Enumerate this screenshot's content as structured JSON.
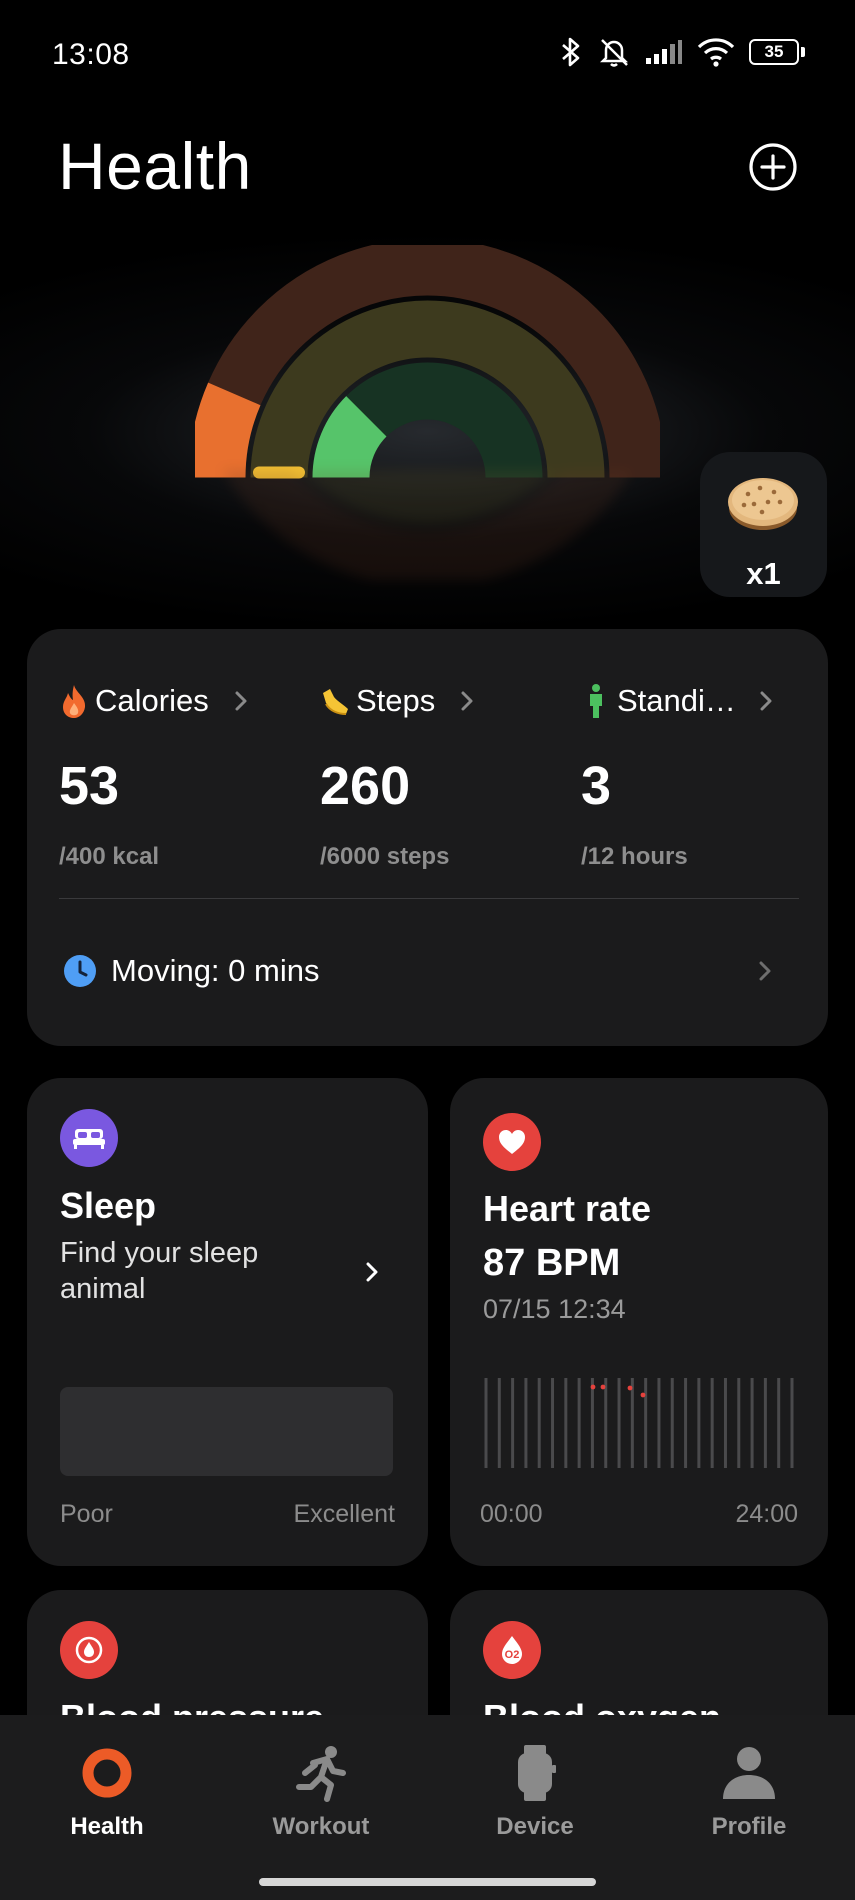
{
  "status_bar": {
    "time": "13:08",
    "battery": "35",
    "icons": [
      "bluetooth-icon",
      "mute-notifications-icon",
      "signal-icon",
      "wifi-icon",
      "battery-icon"
    ]
  },
  "header": {
    "title": "Health",
    "add_icon": "plus-circle-icon"
  },
  "rings": {
    "calories_progress": 0.13,
    "steps_progress": 0.04,
    "standing_progress": 0.25,
    "colors": {
      "calories": "#e8702f",
      "steps": "#f3c033",
      "standing": "#56c46a"
    }
  },
  "reward": {
    "icon": "cookie-icon",
    "count": "x1"
  },
  "activity": {
    "metrics": [
      {
        "label": "Calories",
        "value": "53",
        "goal": "/400 kcal",
        "icon": "flame-icon",
        "color": "#f26a2e"
      },
      {
        "label": "Steps",
        "value": "260",
        "goal": "/6000 steps",
        "icon": "shoe-icon",
        "color": "#f5c435"
      },
      {
        "label": "Standi…",
        "value": "3",
        "goal": "/12 hours",
        "icon": "standing-person-icon",
        "color": "#4cc05f"
      }
    ],
    "moving": {
      "label": "Moving: 0 mins",
      "icon": "clock-icon"
    }
  },
  "sleep": {
    "title": "Sleep",
    "subtitle": "Find your sleep animal",
    "scale_low": "Poor",
    "scale_high": "Excellent",
    "icon": "bed-icon"
  },
  "heart_rate": {
    "title": "Heart rate",
    "value": "87 BPM",
    "timestamp": "07/15 12:34",
    "axis_start": "00:00",
    "axis_end": "24:00",
    "icon": "heart-icon"
  },
  "blood_pressure": {
    "title": "Blood pressure",
    "icon": "blood-drop-icon"
  },
  "blood_oxygen": {
    "title": "Blood oxygen",
    "icon": "o2-icon"
  },
  "nav": [
    {
      "label": "Health",
      "icon": "health-ring-icon",
      "active": true
    },
    {
      "label": "Workout",
      "icon": "running-icon",
      "active": false
    },
    {
      "label": "Device",
      "icon": "watch-icon",
      "active": false
    },
    {
      "label": "Profile",
      "icon": "person-icon",
      "active": false
    }
  ]
}
